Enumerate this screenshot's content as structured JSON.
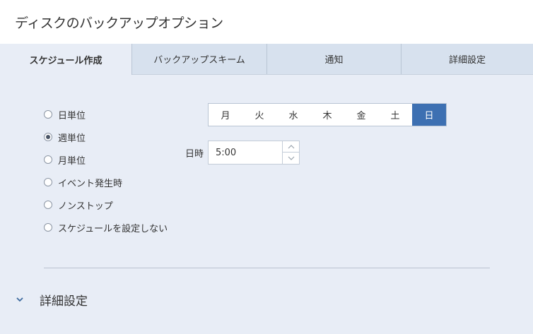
{
  "window": {
    "title": "ディスクのバックアップオプション"
  },
  "tabs": [
    {
      "label": "スケジュール作成",
      "active": true
    },
    {
      "label": "バックアップスキーム",
      "active": false
    },
    {
      "label": "通知",
      "active": false
    },
    {
      "label": "詳細設定",
      "active": false
    }
  ],
  "schedule": {
    "options": [
      {
        "label": "日単位",
        "checked": false
      },
      {
        "label": "週単位",
        "checked": true
      },
      {
        "label": "月単位",
        "checked": false
      },
      {
        "label": "イベント発生時",
        "checked": false
      },
      {
        "label": "ノンストップ",
        "checked": false
      },
      {
        "label": "スケジュールを設定しない",
        "checked": false
      }
    ],
    "days": [
      {
        "label": "月",
        "selected": false
      },
      {
        "label": "火",
        "selected": false
      },
      {
        "label": "水",
        "selected": false
      },
      {
        "label": "木",
        "selected": false
      },
      {
        "label": "金",
        "selected": false
      },
      {
        "label": "土",
        "selected": false
      },
      {
        "label": "日",
        "selected": true
      }
    ],
    "time_label": "日時",
    "time_value": "5:00"
  },
  "advanced": {
    "label": "詳細設定",
    "icon": "chevron-down-icon"
  },
  "colors": {
    "accent": "#3d70b2",
    "background": "#e8edf6",
    "tab_bar": "#d7e1ee"
  }
}
